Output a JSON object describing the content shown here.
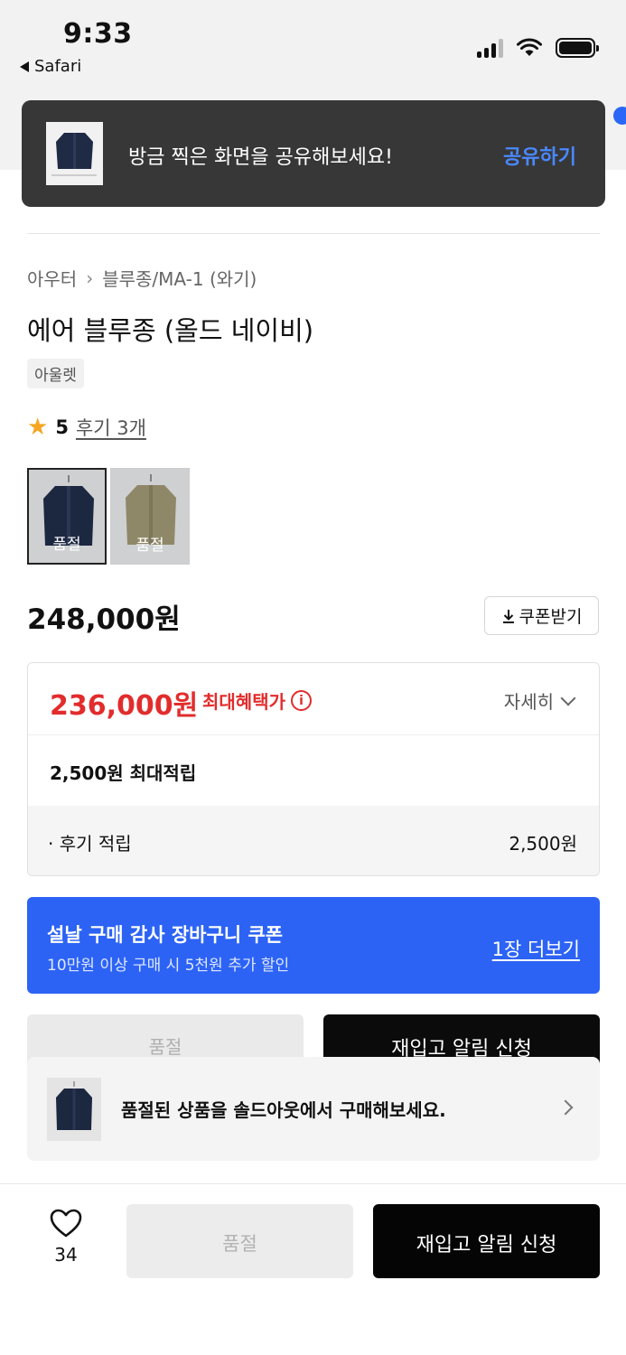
{
  "status": {
    "time": "9:33",
    "back_app": "Safari"
  },
  "toast": {
    "message": "방금 찍은 화면을 공유해보세요!",
    "action": "공유하기"
  },
  "breadcrumb": [
    "아우터",
    "블루종/MA-1 (와기)"
  ],
  "product": {
    "title": "에어 블루종 (올드 네이비)",
    "badge": "아울렛",
    "rating": "5",
    "reviews": "후기 3개",
    "swatches": [
      {
        "label": "품절",
        "color": "navy"
      },
      {
        "label": "품절",
        "color": "olive"
      }
    ],
    "price": "248,000원",
    "coupon_button": "쿠폰받기"
  },
  "benefit": {
    "max_price": "236,000원",
    "max_label": "최대혜택가",
    "info_icon": "ⓘ",
    "detail": "자세히",
    "points": "2,500원 최대적립",
    "review_label": "· 후기 적립",
    "review_value": "2,500원"
  },
  "promo": {
    "title": "설날 구매 감사 장바구니 쿠폰",
    "subtitle": "10만원 이상 구매 시 5천원 추가 할인",
    "more": "1장 더보기"
  },
  "mid_buttons": {
    "sold": "품절",
    "notify": "재입고 알림 신청"
  },
  "soldout_banner": {
    "text": "품절된 상품을 솔드아웃에서 구매해보세요."
  },
  "bottom_bar": {
    "likes": "34",
    "sold": "품절",
    "notify": "재입고 알림 신청"
  },
  "colors": {
    "accent_blue": "#2c63f5",
    "sale_red": "#e22c2c",
    "star": "#f5a623"
  }
}
